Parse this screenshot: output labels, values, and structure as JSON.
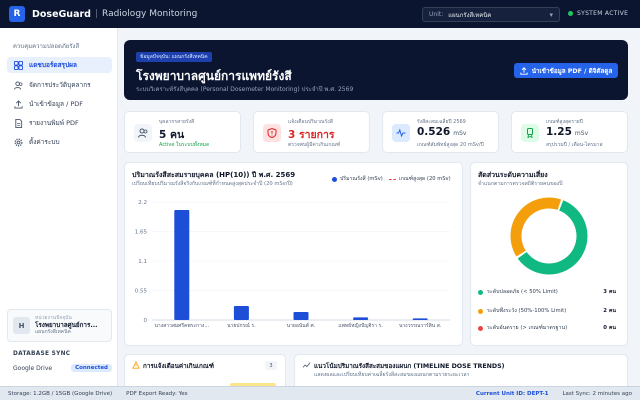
{
  "header": {
    "logo_letter": "R",
    "app_name": "DoseGuard",
    "separator": "|",
    "subtitle": "Radiology Monitoring",
    "unit_label": "Unit:",
    "unit_value": "แผนกรังสีเทคนิค",
    "system_status": "SYSTEM ACTIVE"
  },
  "sidebar": {
    "heading": "ควบคุมความปลอดภัยรังสี",
    "items": [
      {
        "label": "แดชบอร์ดสรุปผล",
        "icon": "dashboard-icon",
        "active": true
      },
      {
        "label": "จัดการประวัติบุคลากร",
        "icon": "users-icon",
        "active": false
      },
      {
        "label": "นำเข้าข้อมูล / PDF",
        "icon": "upload-icon",
        "active": false
      },
      {
        "label": "รายงานพิมพ์ PDF",
        "icon": "report-icon",
        "active": false
      },
      {
        "label": "ตั้งค่าระบบ",
        "icon": "gear-icon",
        "active": false
      }
    ],
    "user": {
      "avatar_letter": "H",
      "role": "หน่วยงานปัจจุบัน",
      "name": "โรงพยาบาลศูนย์การ...",
      "unit": "แผนกรังสีเทคนิค"
    },
    "db_sync": {
      "heading": "DATABASE SYNC",
      "provider": "Google Drive",
      "status": "Connected"
    }
  },
  "hero": {
    "tag": "ข้อมูลปัจจุบัน: แผนกรังสีเทคนิค",
    "title": "โรงพยาบาลศูนย์การแพทย์รังสี",
    "subtitle": "ระบบวิเคราะห์รังสีบุคคล (Personal Dosemeter Monitoring) ประจำปี พ.ศ. 2569",
    "import_button": "นำเข้าข้อมูล PDF / ดิจิตัลดูล"
  },
  "stats": [
    {
      "label": "บุคลากรสายรังสี",
      "value": "5 คน",
      "unit": "",
      "sub": "Active ในระบบทั้งหมด",
      "icon": "people-icon",
      "accent": "#475569",
      "bg": "#f1f5f9",
      "valcolor": "#0f172a",
      "subcolor": "#16a34a"
    },
    {
      "label": "แจ้งเตือนปริมาณรังสี",
      "value": "3 รายการ",
      "unit": "",
      "sub": "ตรวจพบผู้มีค่าเกินเกณฑ์",
      "icon": "shield-alert-icon",
      "accent": "#dc2626",
      "bg": "#fee2e2",
      "valcolor": "#dc2626",
      "subcolor": "#64748b"
    },
    {
      "label": "รังสีสะสมเฉลี่ยปี 2569",
      "value": "0.526",
      "unit": "mSv",
      "sub": "เกณฑ์สัมพัทธ์สูงสุด 20 mSv/ปี",
      "icon": "pulse-icon",
      "accent": "#2563eb",
      "bg": "#dbeafe",
      "valcolor": "#0f172a",
      "subcolor": "#64748b"
    },
    {
      "label": "เกณฑ์สูงสุดรายปี",
      "value": "1.25",
      "unit": "mSv",
      "sub": "สรุปรวมปี / เดือน-ไตรมาส",
      "icon": "badge-icon",
      "accent": "#16a34a",
      "bg": "#dcfce7",
      "valcolor": "#0f172a",
      "subcolor": "#64748b"
    }
  ],
  "bar_card": {
    "title": "ปริมาณรังสีสะสมรายบุคคล (HP(10)) ปี พ.ศ. 2569",
    "subtitle": "เปรียบเทียบปริมาณรังสีจริงกับเกณฑ์ที่กำหนดสูงสุดประจำปี (20 mSv/ปี)",
    "legend_actual": "ปริมาณรังสี (mSv)",
    "legend_limit": "เกณฑ์สูงสุด (20 mSv)"
  },
  "chart_data": [
    {
      "type": "bar",
      "categories": [
        "นางสาวสมศรีคพระกาง...",
        "นายปกรณ์ ร.",
        "นายอนันต์ ศ.",
        "แพทย์หญิงปัญจิรา ร.",
        "นางวรรณวาร์สิน ส."
      ],
      "series": [
        {
          "name": "ปริมาณรังสี (mSv)",
          "values": [
            2.05,
            0.26,
            0.15,
            0.05,
            0.03
          ]
        }
      ],
      "limit_name": "เกณฑ์สูงสุด (20 mSv)",
      "ylim": [
        0,
        2.2
      ],
      "yticks": [
        0,
        0.55,
        1.1,
        1.65,
        2.2
      ],
      "ytick_labels": [
        "0",
        "0.55",
        "1.1",
        "1.65",
        "2.2"
      ],
      "color": "#1d4ed8",
      "grid": true
    },
    {
      "type": "pie",
      "categories": [
        "ระดับปลอดภัย (< 50% Limit)",
        "ระดับพึงระวัง (50%-100% Limit)",
        "ระดับอันตราย (> เกณฑ์มาตรฐาน)"
      ],
      "values": [
        3,
        2,
        0
      ],
      "value_labels": [
        "3 คน",
        "2 คน",
        "0 คน"
      ],
      "colors": [
        "#10b981",
        "#f59e0b",
        "#ef4444"
      ],
      "title": "สัดส่วนระดับความเสี่ยง",
      "subtitle": "จำแนกตามการตรวจสถิติรายคนของปี"
    }
  ],
  "alerts_card": {
    "title": "การแจ้งเตือนค่าเกินเกณฑ์",
    "count": "3"
  },
  "trend_card": {
    "title": "แนวโน้มปริมาณรังสีสะสมของแผนก (TIMELINE DOSE TRENDS)",
    "subtitle": "แสดงผลและเปรียบเทียบค่าเฉลี่ยรังสีสะสมของแผนกตามรายระยะเวลา"
  },
  "footer": {
    "storage": "Storage: 1.2GB / 15GB (Google Drive)",
    "pdf_status": "PDF Export Ready: Yes",
    "unit_id": "Current Unit ID: DEPT-1",
    "last_sync": "Last Sync: 2 minutes ago"
  }
}
